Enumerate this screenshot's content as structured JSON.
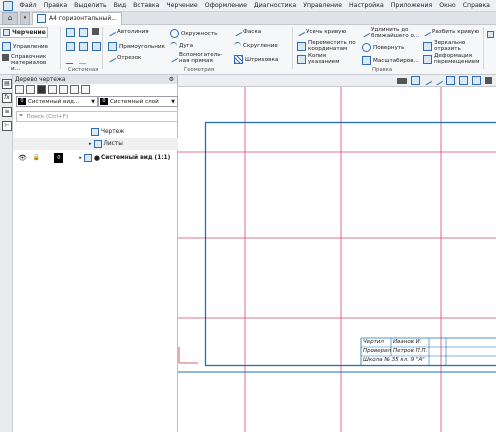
{
  "menu": [
    "Файл",
    "Правка",
    "Выделить",
    "Вид",
    "Вставка",
    "Черчение",
    "Оформление",
    "Диагностика",
    "Управление",
    "Настройка",
    "Приложения",
    "Окно",
    "Справка"
  ],
  "tabs": {
    "document": "А4 горизонтальный..."
  },
  "ribbon": {
    "mode": "Черчение",
    "left_commands": [
      "Управление",
      "Справочник материалов и..."
    ],
    "system_group": "Системная",
    "geometry_group": "Геометрия",
    "edit_group": "Правка",
    "geometry": [
      "Автолиния",
      "Окружность",
      "Фаска",
      "Прямоугольник",
      "Дуга",
      "Скругление",
      "Отрезок",
      "Вспомогатель-\nная прямая",
      "Штриховка"
    ],
    "edit": [
      "Усечь кривую",
      "Удлинить до\nближайшего о...",
      "Разбить кривую",
      "Переместить по\nкоординатам",
      "Повернуть",
      "Зеркально\nотразить",
      "Копия\nуказанием",
      "Масштабиров...",
      "Деформация\nперемещением"
    ]
  },
  "panel": {
    "title": "Дерево чертежа",
    "view_select": "Системный вид...",
    "layer_select": "Системный слой",
    "layer_num": "0",
    "search_placeholder": "Поиск (Ctrl+F)",
    "tree": [
      {
        "label": "Чертеж"
      },
      {
        "label": "Листы"
      },
      {
        "label": "Системный вид (1:1)",
        "num": "0"
      }
    ]
  },
  "title_block": {
    "r1_role": "Чертил",
    "r1_name": "Иванов И.",
    "r2_role": "Проверил",
    "r2_name": "Петров П.П.",
    "r3": "Школа № 35   кл. 9 \"А\""
  },
  "colors": {
    "frame": "#1f6fb4",
    "grid": "#d4477a",
    "accent": "#2c6fa6"
  }
}
